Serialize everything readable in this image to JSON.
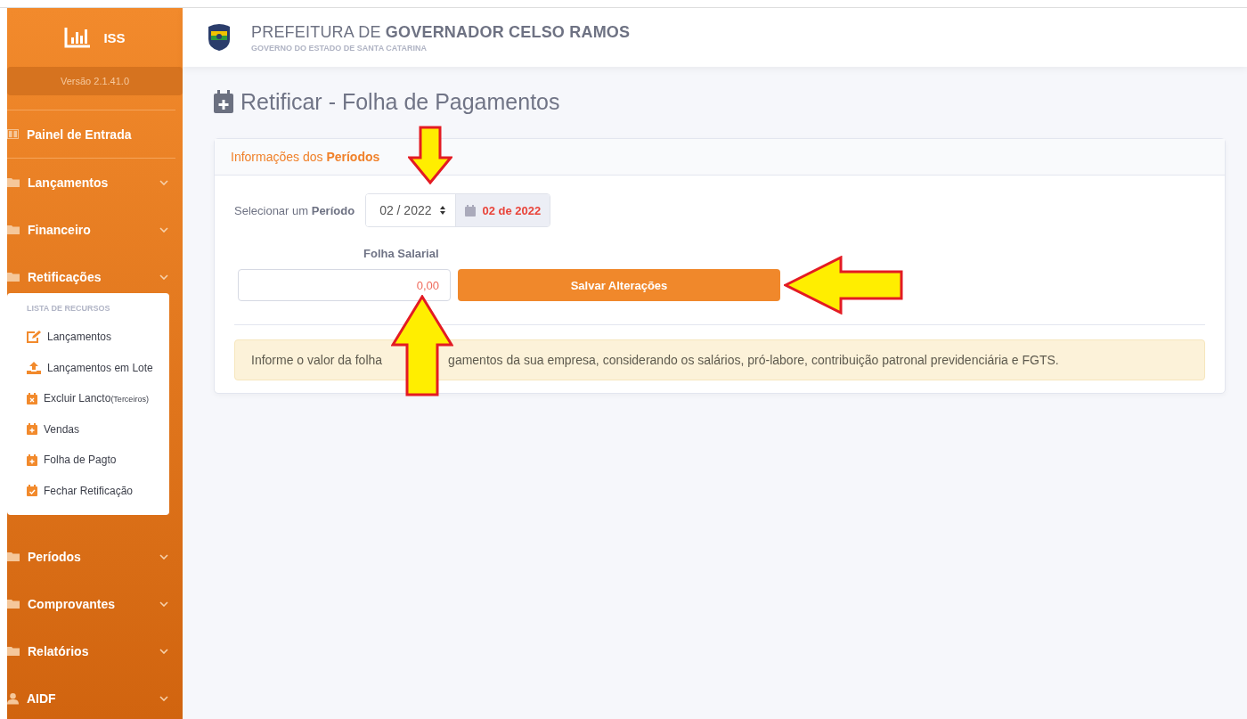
{
  "sidebar": {
    "app_name": "ISS",
    "version": "Versão 2.1.41.0",
    "items": [
      {
        "label": "Painel de Entrada",
        "kind": "link"
      },
      {
        "label": "Lançamentos",
        "kind": "group"
      },
      {
        "label": "Financeiro",
        "kind": "group"
      },
      {
        "label": "Retificações",
        "kind": "group",
        "submenu": {
          "heading": "LISTA DE RECURSOS",
          "items": [
            {
              "label": "Lançamentos"
            },
            {
              "label": "Lançamentos em Lote"
            },
            {
              "label": "Excluir Lancto",
              "note": "(Terceiros)"
            },
            {
              "label": "Vendas"
            },
            {
              "label": "Folha de Pagto"
            },
            {
              "label": "Fechar Retificação"
            }
          ]
        }
      },
      {
        "label": "Períodos",
        "kind": "group"
      },
      {
        "label": "Comprovantes",
        "kind": "group"
      },
      {
        "label": "Relatórios",
        "kind": "group"
      },
      {
        "label": "AIDF",
        "kind": "group"
      }
    ]
  },
  "header": {
    "title": "PREFEITURA DE **GOVERNADOR CELSO RAMOS**",
    "subtitle": "GOVERNO DO ESTADO DE SANTA CATARINA"
  },
  "page_title": "Retificar - Folha de Pagamentos",
  "card": {
    "title": "Informações dos **Períodos**",
    "period_label": "Selecionar um **Período**",
    "period_value": "02 / 2022",
    "period_display": "02 de 2022",
    "field_label": "Folha Salarial",
    "field_value": "0,00",
    "save_button": "Salvar Alterações",
    "notice_parts": [
      "Informe o valor da folha",
      "gamentos da sua empresa, considerando os salários, pró-labore, contribuição patronal previdenciária e FGTS."
    ]
  }
}
